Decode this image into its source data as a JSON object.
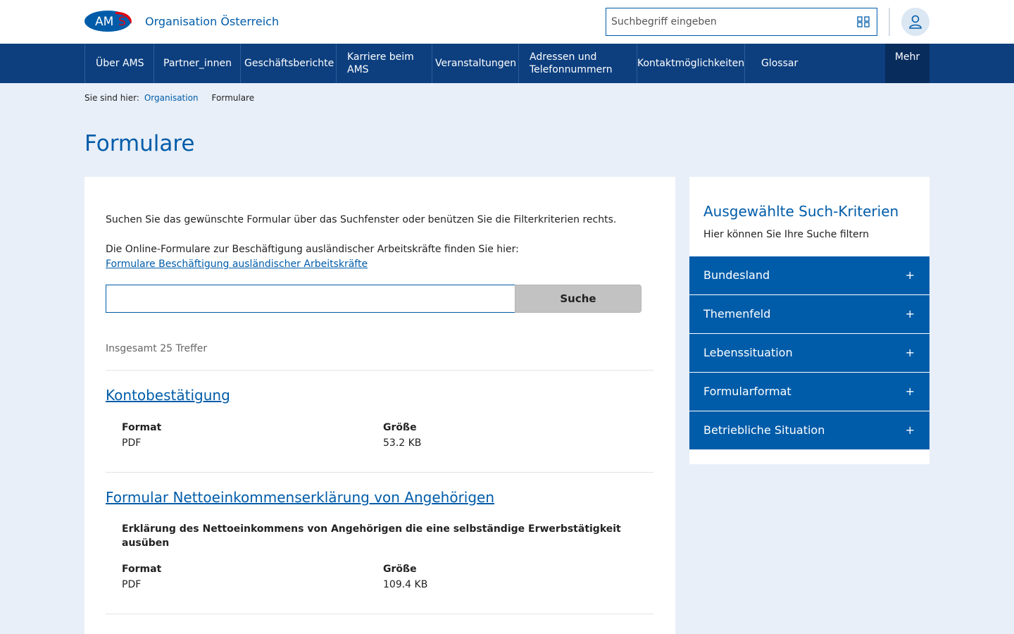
{
  "header": {
    "logo_text": "AMS",
    "org_label": "Organisation Österreich",
    "org_glyph": "",
    "search_placeholder": "Suchbegriff eingeben",
    "icons": {
      "qr": "qr-code-icon",
      "user": "user-icon"
    }
  },
  "nav": {
    "items": [
      {
        "label": "Über AMS"
      },
      {
        "label": "Partner_innen"
      },
      {
        "label": "Geschäftsberichte"
      },
      {
        "label": "Karriere beim AMS"
      },
      {
        "label": "Veranstaltungen"
      },
      {
        "label": "Adressen und Telefonnummern"
      },
      {
        "label": "Kontaktmöglichkeiten"
      },
      {
        "label": "Glossar"
      }
    ],
    "more_label": "Mehr",
    "more_glyph": ""
  },
  "breadcrumb": {
    "prefix": "Sie sind hier:",
    "link": "Organisation",
    "sep": "",
    "current": "Formulare"
  },
  "page": {
    "title": "Formulare"
  },
  "main": {
    "intro1": "Suchen Sie das gewünschte Formular über das Suchfenster oder benützen Sie die Filterkriterien rechts.",
    "intro2": "Die Online-Formulare zur Beschäftigung ausländischer Arbeitskräfte finden Sie hier:",
    "intro2_link": "Formulare Beschäftigung ausländischer Arbeitskräfte",
    "search_value": "",
    "search_button": "Suche",
    "result_count": "Insgesamt 25 Treffer",
    "results": [
      {
        "title": "Kontobestätigung",
        "icon": "",
        "format_label": "Format",
        "format": "PDF",
        "size_label": "Größe",
        "size": "53.2 KB"
      },
      {
        "title": "Formular Nettoeinkommenserklärung von Angehörigen",
        "icon": "",
        "description": "Erklärung des Nettoeinkommens von Angehörigen die eine selbständige Erwerbstätigkeit ausüben",
        "format_label": "Format",
        "format": "PDF",
        "size_label": "Größe",
        "size": "109.4 KB"
      }
    ]
  },
  "sidebar": {
    "title": "Ausgewählte Such-Kriterien",
    "subtitle": "Hier können Sie Ihre Suche filtern",
    "plus_glyph": "+",
    "filters": [
      {
        "label": "Bundesland"
      },
      {
        "label": "Themenfeld"
      },
      {
        "label": "Lebenssituation"
      },
      {
        "label": "Formularformat"
      },
      {
        "label": "Betriebliche Situation"
      }
    ]
  },
  "colors": {
    "brand_blue": "#005ca9",
    "nav_blue": "#0d3f7f",
    "logo_red": "#e30613",
    "page_bg": "#e8eff8"
  }
}
